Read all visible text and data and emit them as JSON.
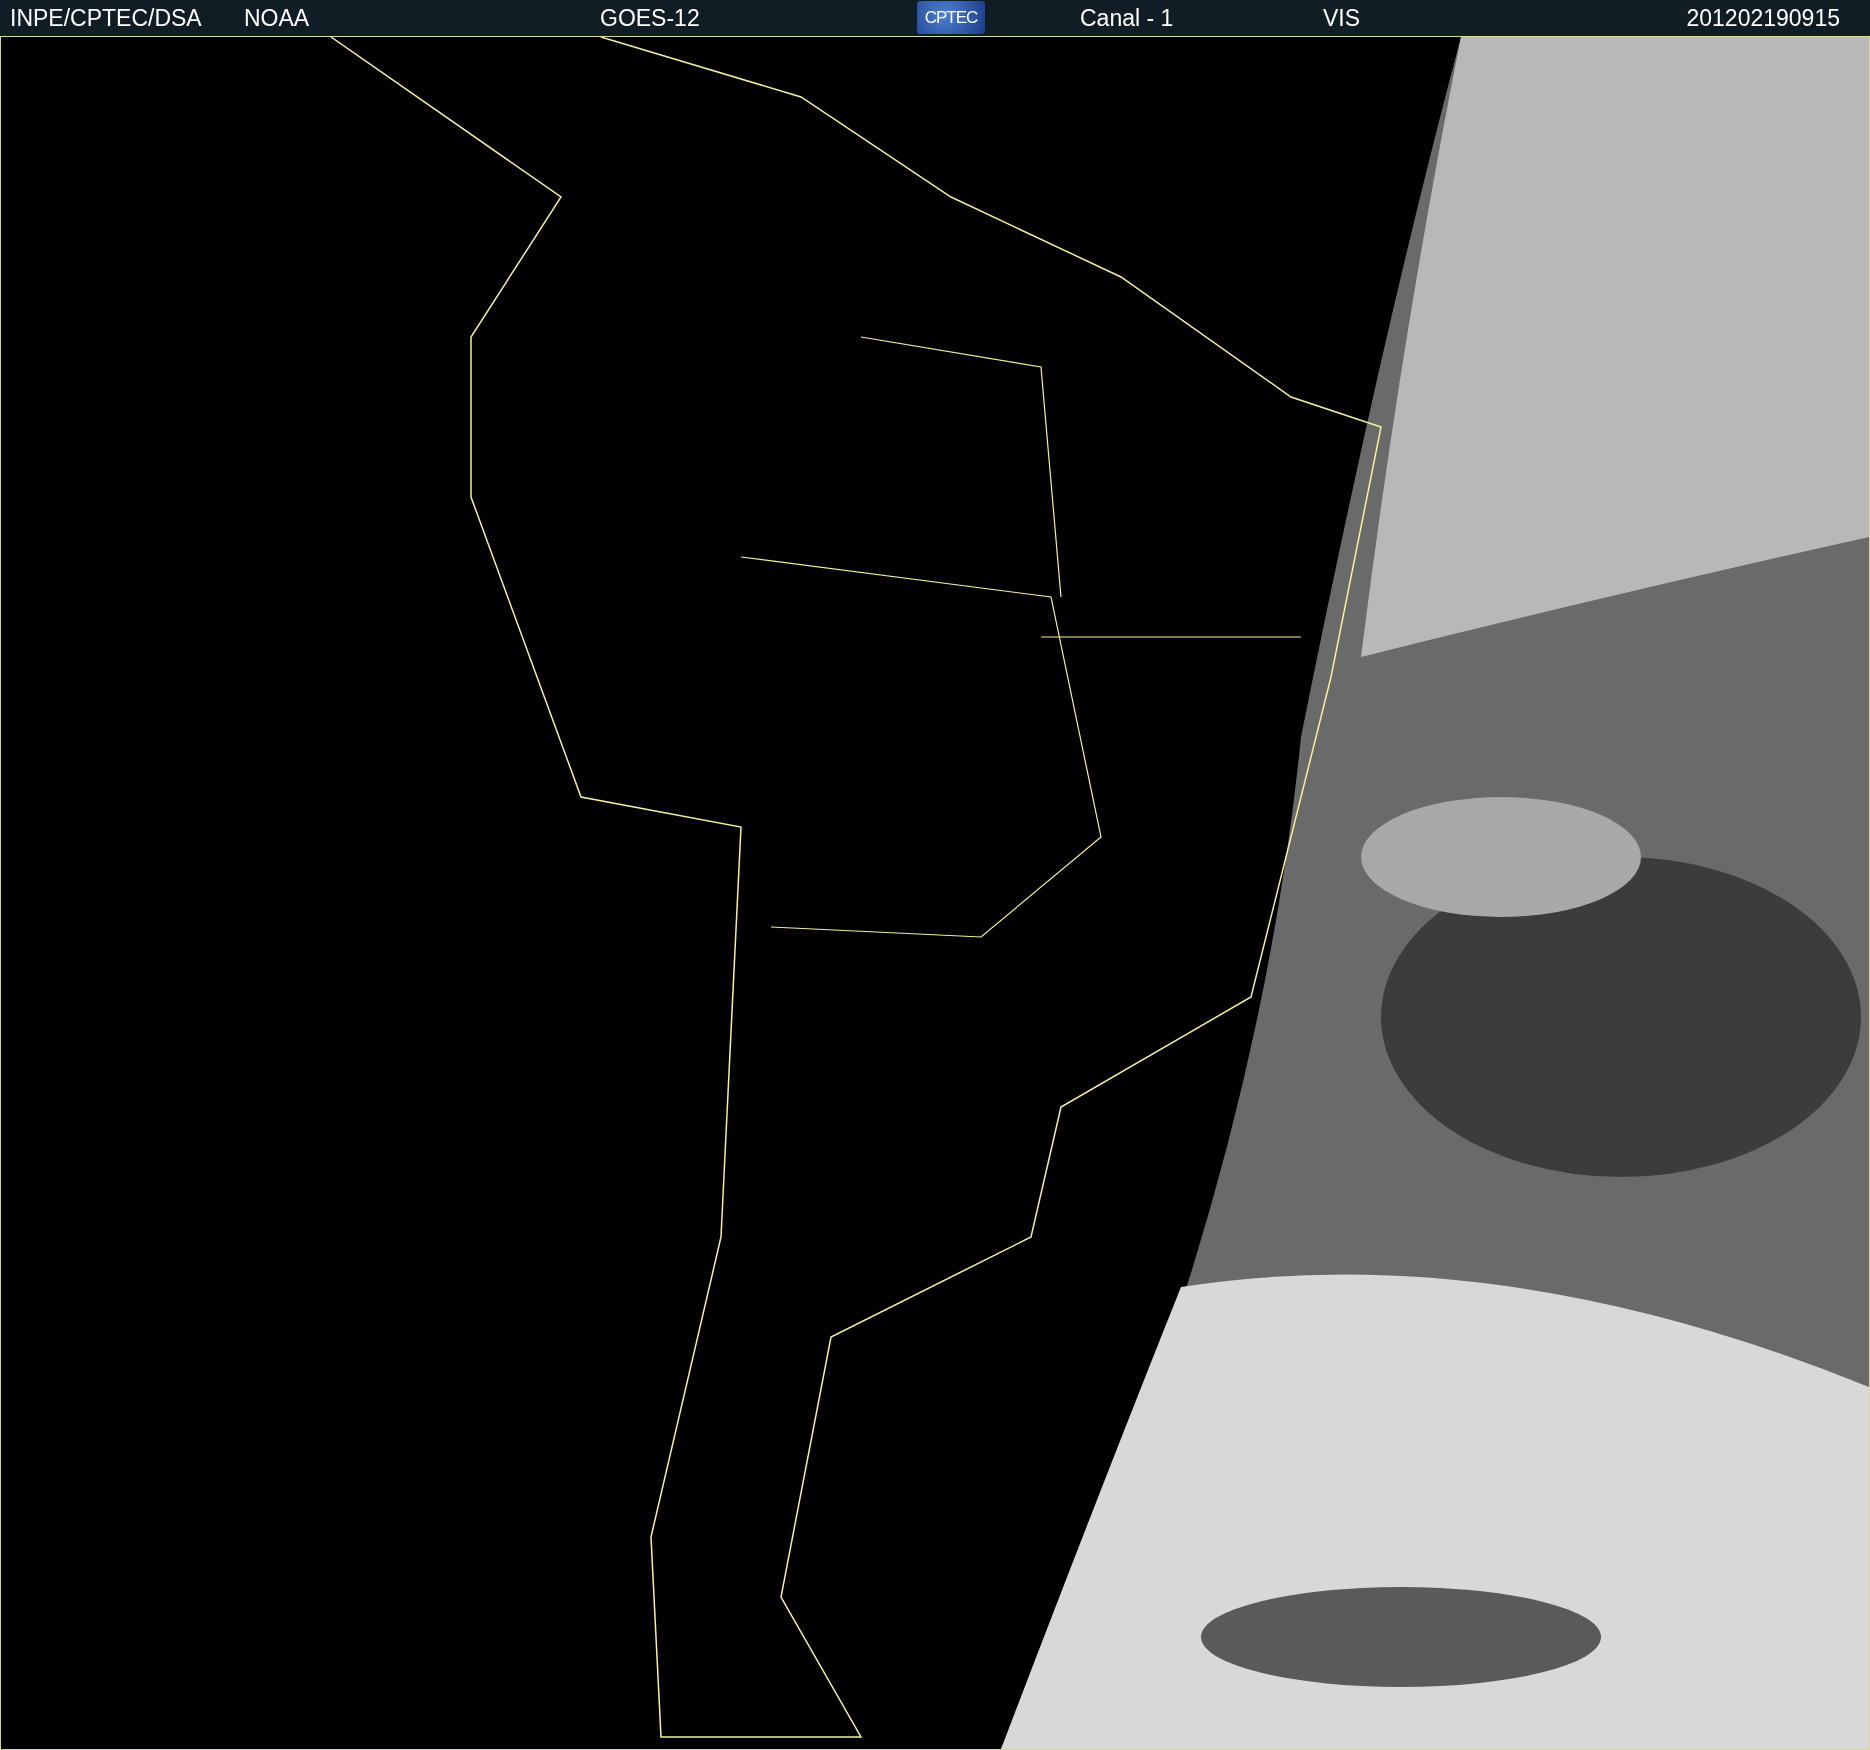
{
  "header": {
    "items": [
      {
        "kind": "text",
        "text": "INPE/CPTEC/DSA"
      },
      {
        "kind": "text",
        "text": "NOAA"
      },
      {
        "kind": "text",
        "text": "GOES-12"
      },
      {
        "kind": "logo",
        "text": "CPTEC"
      },
      {
        "kind": "text",
        "text": "Canal - 1"
      },
      {
        "kind": "text",
        "text": "VIS"
      },
      {
        "kind": "text",
        "text": "201202190915"
      }
    ]
  }
}
